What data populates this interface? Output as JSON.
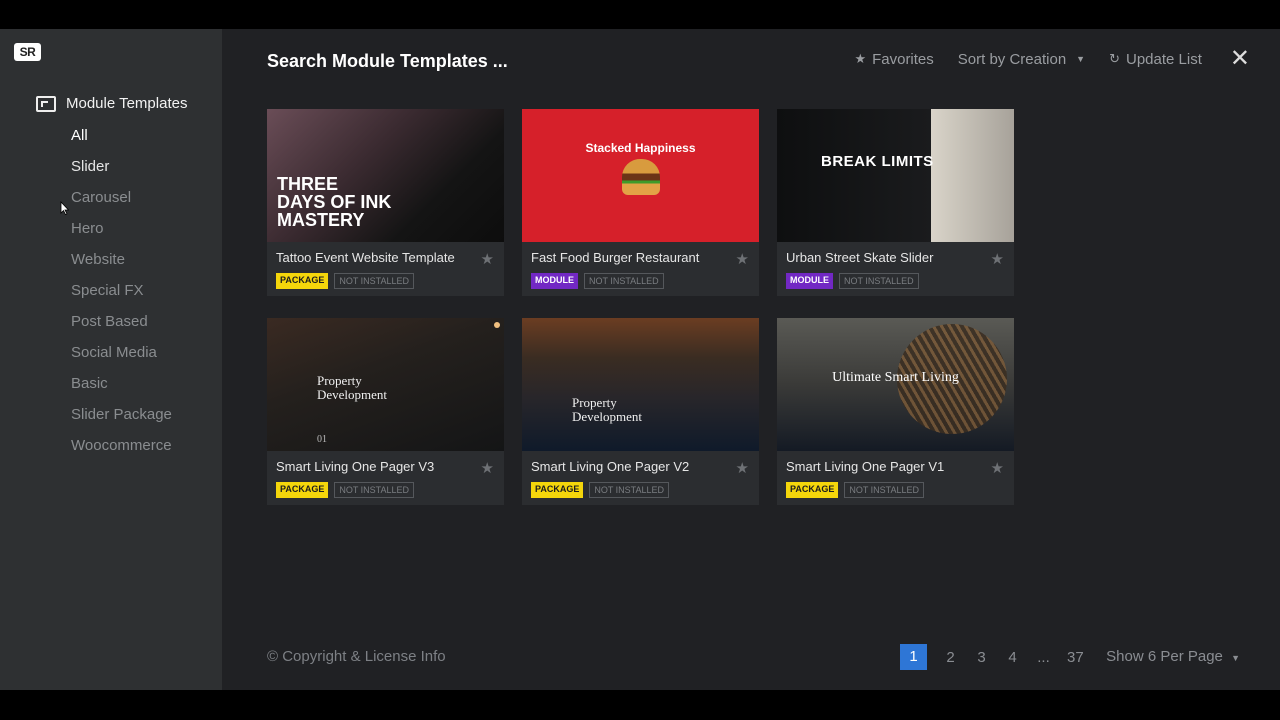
{
  "logo": "SR",
  "sidebar": {
    "header_label": "Module Templates",
    "items": [
      {
        "label": "All",
        "state": "active"
      },
      {
        "label": "Slider",
        "state": "hover"
      },
      {
        "label": "Carousel",
        "state": ""
      },
      {
        "label": "Hero",
        "state": ""
      },
      {
        "label": "Website",
        "state": ""
      },
      {
        "label": "Special FX",
        "state": ""
      },
      {
        "label": "Post Based",
        "state": ""
      },
      {
        "label": "Social Media",
        "state": ""
      },
      {
        "label": "Basic",
        "state": ""
      },
      {
        "label": "Slider Package",
        "state": ""
      },
      {
        "label": "Woocommerce",
        "state": ""
      }
    ]
  },
  "header": {
    "search_placeholder": "Search Module Templates ...",
    "favorites_label": "Favorites",
    "sort_label": "Sort by Creation",
    "update_label": "Update List"
  },
  "cards": [
    {
      "title": "Tattoo Event Website Template",
      "badge": "PACKAGE",
      "badge_type": "package",
      "status": "NOT INSTALLED",
      "thumb_text": "THREE\nDAYS OF INK\nMASTERY",
      "thumb_class": "t-tattoo"
    },
    {
      "title": "Fast Food Burger Restaurant",
      "badge": "MODULE",
      "badge_type": "module",
      "status": "NOT INSTALLED",
      "thumb_text": "Stacked Happiness",
      "thumb_class": "t-burger"
    },
    {
      "title": "Urban Street Skate Slider",
      "badge": "MODULE",
      "badge_type": "module",
      "status": "NOT INSTALLED",
      "thumb_text": "BREAK LIMITS",
      "thumb_class": "t-skate"
    },
    {
      "title": "Smart Living One Pager V3",
      "badge": "PACKAGE",
      "badge_type": "package",
      "status": "NOT INSTALLED",
      "thumb_text": "Property\nDevelopment",
      "thumb_class": "t-v3",
      "thumb_num": "01"
    },
    {
      "title": "Smart Living One Pager V2",
      "badge": "PACKAGE",
      "badge_type": "package",
      "status": "NOT INSTALLED",
      "thumb_text": "Property\nDevelopment",
      "thumb_class": "t-v2"
    },
    {
      "title": "Smart Living One Pager V1",
      "badge": "PACKAGE",
      "badge_type": "package",
      "status": "NOT INSTALLED",
      "thumb_text": "Ultimate Smart Living",
      "thumb_class": "t-v1"
    }
  ],
  "footer": {
    "copyright": "© Copyright & License Info",
    "pages": [
      "1",
      "2",
      "3",
      "4",
      "...",
      "37"
    ],
    "current_page": "1",
    "per_page_label": "Show 6 Per Page"
  },
  "colors": {
    "accent": "#2e76d6",
    "package_badge": "#f5d60b",
    "module_badge": "#7228c4"
  }
}
